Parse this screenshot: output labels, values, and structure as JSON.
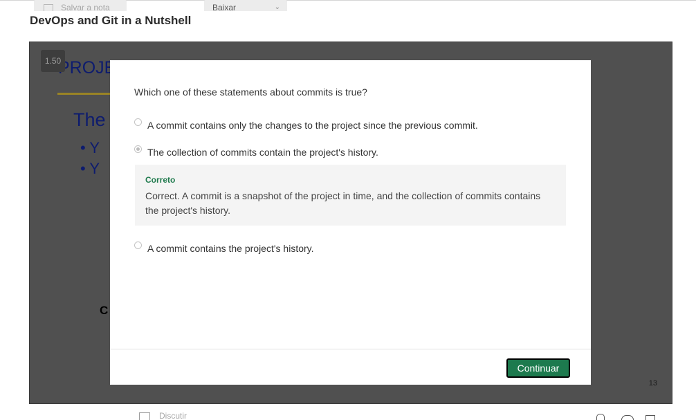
{
  "page": {
    "title": "DevOps and Git in a Nutshell"
  },
  "player": {
    "speed": "1.50",
    "slide_title": "PROJE",
    "slide_subtitle": "The",
    "bullet_1": "•  Y",
    "bullet_2": "•  Y",
    "fragment": "C",
    "page_number": "13"
  },
  "quiz": {
    "question": "Which one of these statements about commits is true?",
    "options": [
      {
        "label": "A commit contains only the changes to the project since the previous commit.",
        "selected": false
      },
      {
        "label": "The collection of commits contain the project's history.",
        "selected": true
      },
      {
        "label": "A commit contains the project's history.",
        "selected": false
      }
    ],
    "feedback": {
      "title": "Correto",
      "text": "Correct. A commit is a snapshot of the project in time, and the collection of commits contains the project's history."
    },
    "continue_label": "Continuar"
  },
  "toolbar": {
    "note_label": "Salvar a nota",
    "discuss_label": "Discutir",
    "download_label": "Baixar"
  },
  "colors": {
    "accent_green": "#1d7a4e",
    "feedback_green": "#1f7a4d",
    "slide_blue": "#0e1c6e"
  }
}
